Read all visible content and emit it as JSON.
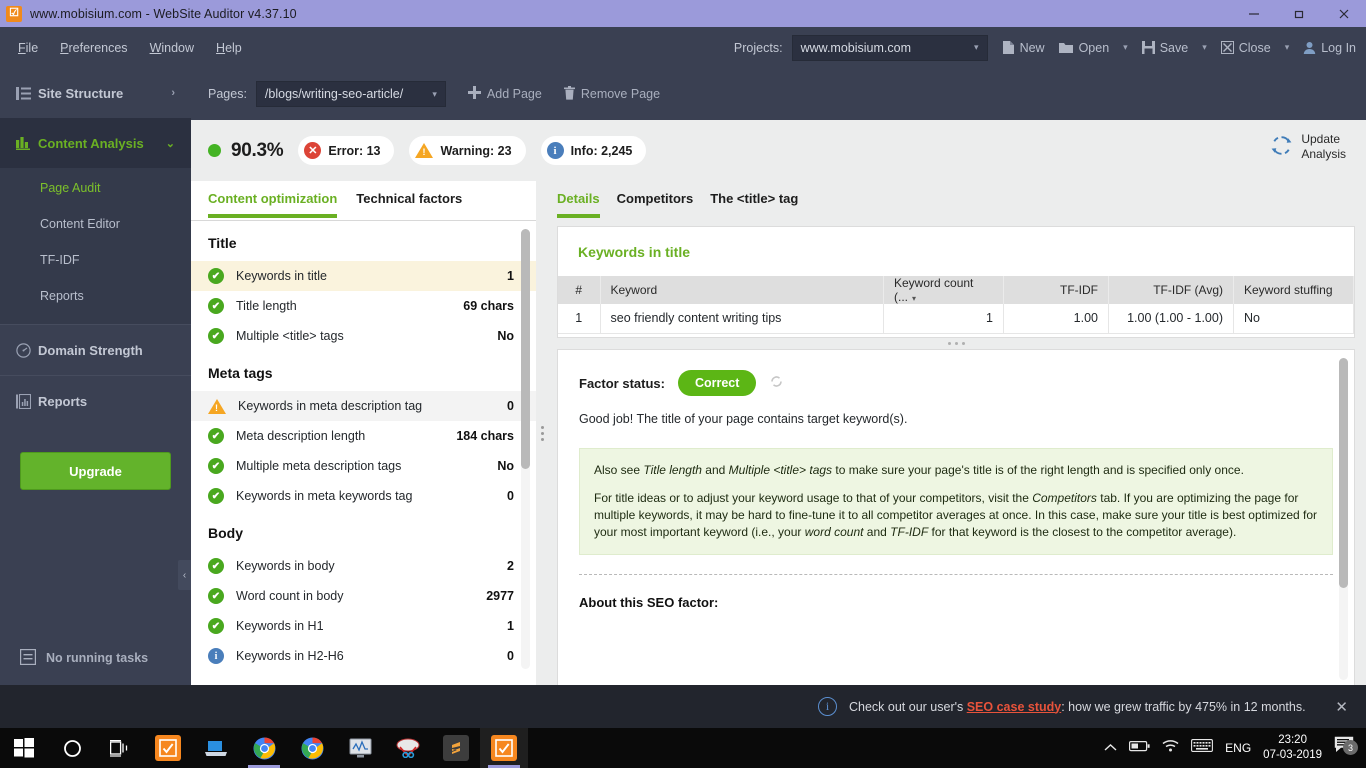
{
  "titlebar": {
    "title": "www.mobisium.com - WebSite Auditor v4.37.10",
    "app_icon": "checkbox-icon",
    "minimize": "minimize-icon",
    "maximize": "restore-icon",
    "close": "close-icon"
  },
  "menubar": {
    "items": [
      {
        "label": "File",
        "mnemonic": "F"
      },
      {
        "label": "Preferences",
        "mnemonic": "P"
      },
      {
        "label": "Window",
        "mnemonic": "W"
      },
      {
        "label": "Help",
        "mnemonic": "H"
      }
    ],
    "projects_label": "Projects:",
    "project_value": "www.mobisium.com",
    "actions": [
      {
        "label": "New",
        "icon": "file-icon",
        "caret": false
      },
      {
        "label": "Open",
        "icon": "folder-open-icon",
        "caret": true
      },
      {
        "label": "Save",
        "icon": "floppy-disk-icon",
        "caret": true
      },
      {
        "label": "Close",
        "icon": "close-box-icon",
        "caret": true
      },
      {
        "label": "Log In",
        "icon": "user-icon",
        "caret": false
      }
    ]
  },
  "sidebar": {
    "items": [
      {
        "label": "Site Structure",
        "icon": "list-icon",
        "chevron": "›",
        "active": false
      },
      {
        "label": "Content Analysis",
        "icon": "bar-chart-icon",
        "chevron": "⌄",
        "active": true
      }
    ],
    "sub_items": [
      {
        "label": "Page Audit",
        "selected": true
      },
      {
        "label": "Content Editor",
        "selected": false
      },
      {
        "label": "TF-IDF",
        "selected": false
      },
      {
        "label": "Reports",
        "selected": false
      }
    ],
    "lower_items": [
      {
        "label": "Domain Strength",
        "icon": "gauge-icon"
      },
      {
        "label": "Reports",
        "icon": "document-chart-icon"
      }
    ],
    "upgrade_label": "Upgrade",
    "tasks_label": "No running tasks",
    "tasks_icon": "tasks-icon",
    "collapse_icon": "‹"
  },
  "pages_bar": {
    "label": "Pages:",
    "value": "/blogs/writing-seo-article/",
    "add_page": "Add Page",
    "remove_page": "Remove Page"
  },
  "score_bar": {
    "percent": "90.3%",
    "error": "Error: 13",
    "warning": "Warning: 23",
    "info": "Info: 2,245",
    "update_line1": "Update",
    "update_line2": "Analysis",
    "update_icon": "refresh-icon"
  },
  "left_panel": {
    "tabs": [
      {
        "label": "Content optimization",
        "active": true
      },
      {
        "label": "Technical factors",
        "active": false
      }
    ],
    "groups": [
      {
        "title": "Title",
        "rows": [
          {
            "label": "Keywords in title",
            "value": "1",
            "status": "ok",
            "highlight": "selected"
          },
          {
            "label": "Title length",
            "value": "69 chars",
            "status": "ok",
            "highlight": "none"
          },
          {
            "label": "Multiple <title> tags",
            "value": "No",
            "status": "ok",
            "highlight": "none"
          }
        ]
      },
      {
        "title": "Meta tags",
        "rows": [
          {
            "label": "Keywords in meta description tag",
            "value": "0",
            "status": "warn",
            "highlight": "gray"
          },
          {
            "label": "Meta description length",
            "value": "184 chars",
            "status": "ok",
            "highlight": "none"
          },
          {
            "label": "Multiple meta description tags",
            "value": "No",
            "status": "ok",
            "highlight": "none"
          },
          {
            "label": "Keywords in meta keywords tag",
            "value": "0",
            "status": "ok",
            "highlight": "none"
          }
        ]
      },
      {
        "title": "Body",
        "rows": [
          {
            "label": "Keywords in body",
            "value": "2",
            "status": "ok",
            "highlight": "none"
          },
          {
            "label": "Word count in body",
            "value": "2977",
            "status": "ok",
            "highlight": "none"
          },
          {
            "label": "Keywords in H1",
            "value": "1",
            "status": "ok",
            "highlight": "none"
          },
          {
            "label": "Keywords in H2-H6",
            "value": "0",
            "status": "info",
            "highlight": "none"
          }
        ]
      }
    ]
  },
  "right_panel": {
    "tabs": [
      {
        "label": "Details",
        "active": true
      },
      {
        "label": "Competitors",
        "active": false
      },
      {
        "label": "The <title> tag",
        "active": false
      }
    ],
    "card_title": "Keywords in title",
    "table": {
      "columns": [
        "#",
        "Keyword",
        "Keyword count (...",
        "TF-IDF",
        "TF-IDF (Avg)",
        "Keyword stuffing"
      ],
      "rows": [
        {
          "num": "1",
          "keyword": "seo friendly content writing tips",
          "keyword_count": "1",
          "tfidf": "1.00",
          "tfidf_avg": "1.00 (1.00 - 1.00)",
          "stuffing": "No"
        }
      ]
    },
    "factor_status_label": "Factor status:",
    "factor_status_value": "Correct",
    "refresh_icon": "refresh-icon",
    "good_job": "Good job! The title of your page contains target keyword(s).",
    "tip_p1_a": "Also see ",
    "tip_p1_i1": "Title length",
    "tip_p1_b": " and ",
    "tip_p1_i2": "Multiple <title> tags",
    "tip_p1_c": " to make sure your page's title is of the right length and is specified only once.",
    "tip_p2_a": "For title ideas or to adjust your keyword usage to that of your competitors, visit the ",
    "tip_p2_i1": "Competitors",
    "tip_p2_b": " tab. If you are optimizing the page for multiple keywords, it may be hard to fine-tune it to all competitor averages at once. In this case, make sure your title is best optimized for your most important keyword (i.e., your ",
    "tip_p2_i2": "word count",
    "tip_p2_c": " and ",
    "tip_p2_i3": "TF-IDF",
    "tip_p2_d": " for that keyword is the closest to the competitor average).",
    "about_label": "About this SEO factor:"
  },
  "notification": {
    "icon": "info-circle-icon",
    "text_before": "Check out our user's ",
    "link": "SEO case study",
    "text_after": ": how we grew traffic by 475% in 12 months.",
    "close_icon": "close-icon"
  },
  "taskbar": {
    "items": [
      {
        "name": "start-button",
        "icon": "windows-logo-icon"
      },
      {
        "name": "cortana-search",
        "icon": "circle-icon"
      },
      {
        "name": "task-view",
        "icon": "task-view-icon"
      },
      {
        "name": "website-auditor-app",
        "icon": "checkbox-orange-icon"
      },
      {
        "name": "file-explorer-app",
        "icon": "laptop-icon"
      },
      {
        "name": "chrome-app-1",
        "icon": "chrome-icon"
      },
      {
        "name": "chrome-app-2",
        "icon": "chrome-icon"
      },
      {
        "name": "monitor-app",
        "icon": "monitor-chart-icon"
      },
      {
        "name": "snipping-tool-app",
        "icon": "scissors-icon"
      },
      {
        "name": "sublime-text-app",
        "icon": "sublime-icon"
      },
      {
        "name": "website-auditor-active",
        "icon": "checkbox-orange-icon"
      }
    ],
    "tray": {
      "chevron": "show-hidden-icons",
      "battery": "battery-icon",
      "wifi": "wifi-icon",
      "keyboard": "keyboard-icon",
      "language": "ENG",
      "time": "23:20",
      "date": "07-03-2019",
      "notifications_icon": "action-center-icon",
      "notifications_count": "3"
    }
  },
  "colors": {
    "accent_green": "#6ab023",
    "title_purple": "#9b9ada",
    "panel_dark": "#3a4052",
    "error_red": "#dc4437",
    "warning_orange": "#f5a623",
    "info_blue": "#4a7ebb"
  }
}
